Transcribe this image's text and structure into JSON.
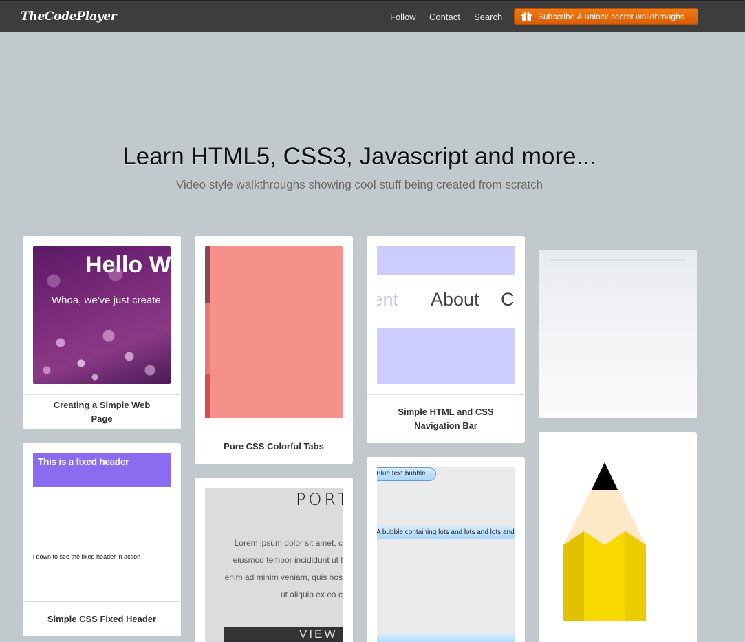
{
  "header": {
    "logo": "TheCodePlayer",
    "nav": [
      "Follow",
      "Contact",
      "Search"
    ],
    "subscribe_label": "Subscribe & unlock secret walkthroughs"
  },
  "hero": {
    "title": "Learn HTML5, CSS3, Javascript and more...",
    "subtitle": "Video style walkthroughs showing cool stuff being created from scratch"
  },
  "cards": [
    {
      "title": "Creating a Simple Web Page",
      "thumb_heading": "Hello Wo",
      "thumb_text": "Whoa, we've just create"
    },
    {
      "title": "Pure CSS Colorful Tabs"
    },
    {
      "title": "Simple HTML and CSS Navigation Bar",
      "thumb_items": [
        "tent",
        "About",
        "C"
      ]
    },
    {
      "title": ""
    },
    {
      "title": "Simple CSS Fixed Header",
      "thumb_header": "This is a fixed header",
      "thumb_text": "l down to see the fixed header in action"
    },
    {
      "title": "",
      "thumb_heading": "PORT",
      "thumb_lines": [
        "Lorem ipsum dolor sit amet, c",
        "eiusmod tempor incididunt ut l",
        "enim ad minim veniam, quis nos",
        "ut aliquip ex ea c"
      ],
      "thumb_button": "VIEW"
    },
    {
      "title": "",
      "thumb_bubbles": [
        "Blue text bubble",
        "A bubble containing lots and lots and lots and",
        ""
      ]
    },
    {
      "title": ""
    }
  ],
  "colors": {
    "background": "#c2c9cc",
    "topbar": "#3d3d3d",
    "subscribe": "#e8690a",
    "tab_pink": "#f5908a",
    "nav_lavender": "#ccccff",
    "fixed_header": "#8a6cf0",
    "pencil_yellow": "#f7d900"
  }
}
